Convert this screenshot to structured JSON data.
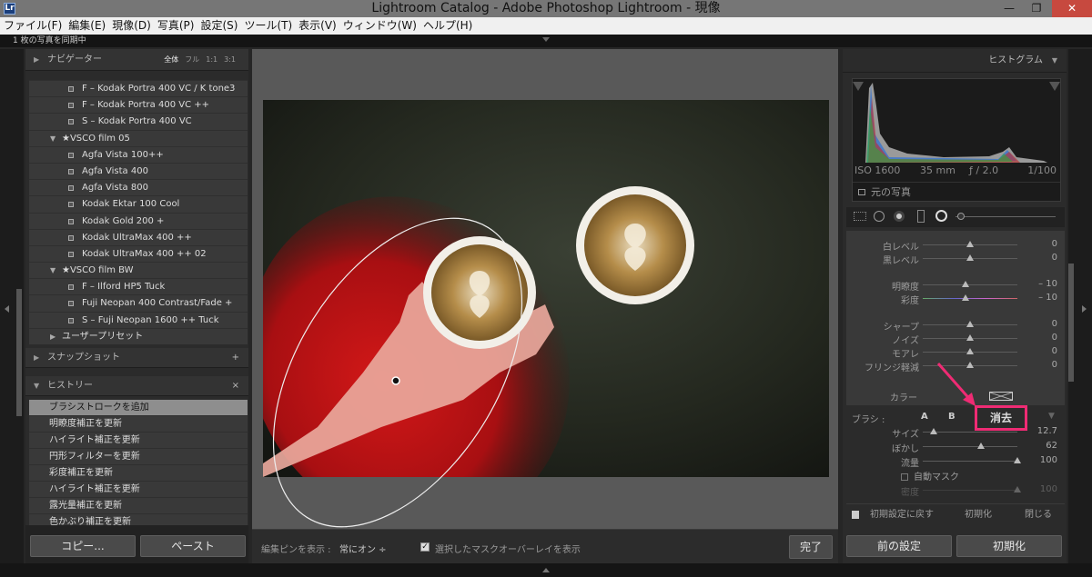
{
  "window": {
    "title": "Lightroom Catalog - Adobe Photoshop Lightroom - 現像",
    "logo": "Lr"
  },
  "menu": [
    "ファイル(F)",
    "編集(E)",
    "現像(D)",
    "写真(P)",
    "設定(S)",
    "ツール(T)",
    "表示(V)",
    "ウィンドウ(W)",
    "ヘルプ(H)"
  ],
  "sync_status": "1 枚の写真を同期中",
  "navigator": {
    "label": "ナビゲーター",
    "options": [
      "全体",
      "フル",
      "1:1",
      "3:1"
    ],
    "active": "全体"
  },
  "presets": [
    {
      "kind": "preset",
      "label": "F – Kodak Portra 400 VC / K tone3"
    },
    {
      "kind": "preset",
      "label": "F – Kodak Portra 400 VC ++"
    },
    {
      "kind": "preset",
      "label": "S – Kodak Portra 400 VC"
    },
    {
      "kind": "folder",
      "label": "★VSCO film 05"
    },
    {
      "kind": "preset",
      "label": "Agfa Vista 100++"
    },
    {
      "kind": "preset",
      "label": "Agfa Vista 400"
    },
    {
      "kind": "preset",
      "label": "Agfa Vista 800"
    },
    {
      "kind": "preset",
      "label": "Kodak Ektar 100 Cool"
    },
    {
      "kind": "preset",
      "label": "Kodak Gold 200 +"
    },
    {
      "kind": "preset",
      "label": "Kodak UltraMax 400 ++"
    },
    {
      "kind": "preset",
      "label": "Kodak UltraMax 400 ++ 02"
    },
    {
      "kind": "folder",
      "label": "★VSCO film BW"
    },
    {
      "kind": "preset",
      "label": "F – Ilford HP5 Tuck"
    },
    {
      "kind": "preset",
      "label": "Fuji Neopan 400 Contrast/Fade +"
    },
    {
      "kind": "preset",
      "label": "S – Fuji Neopan 1600 ++ Tuck"
    },
    {
      "kind": "folder-closed",
      "label": "ユーザープリセット"
    }
  ],
  "snapshot": {
    "label": "スナップショット",
    "add": "+"
  },
  "history": {
    "label": "ヒストリー",
    "clear": "×",
    "items": [
      "ブラシストロークを追加",
      "明瞭度補正を更新",
      "ハイライト補正を更新",
      "円形フィルターを更新",
      "彩度補正を更新",
      "ハイライト補正を更新",
      "露光量補正を更新",
      "色かぶり補正を更新"
    ]
  },
  "left_buttons": {
    "copy": "コピー...",
    "paste": "ペースト"
  },
  "toolbar": {
    "show_pins": "編集ピンを表示 :",
    "pins_value": "常にオン ÷",
    "overlay_label": "選択したマスクオーバーレイを表示",
    "overlay_checked": "✓",
    "done": "完了"
  },
  "histogram": {
    "label": "ヒストグラム",
    "iso": "ISO 1600",
    "focal": "35 mm",
    "aperture": "ƒ / 2.0",
    "shutter": "1/100",
    "original": "元の写真"
  },
  "sliders": [
    {
      "label": "白レベル",
      "value": "0",
      "pos": 0.5
    },
    {
      "label": "黒レベル",
      "value": "0",
      "pos": 0.5
    },
    {
      "label": "明瞭度",
      "value": "– 10",
      "pos": 0.45
    },
    {
      "label": "彩度",
      "value": "– 10",
      "pos": 0.45
    },
    {
      "label": "シャープ",
      "value": "0",
      "pos": 0.5
    },
    {
      "label": "ノイズ",
      "value": "0",
      "pos": 0.5
    },
    {
      "label": "モアレ",
      "value": "0",
      "pos": 0.5
    },
    {
      "label": "フリンジ軽減",
      "value": "0",
      "pos": 0.5
    }
  ],
  "color_label": "カラー",
  "brush": {
    "label": "ブラシ :",
    "a": "A",
    "b": "B",
    "erase": "消去"
  },
  "brush_sliders": [
    {
      "label": "サイズ",
      "value": "12.7",
      "pos": 0.12
    },
    {
      "label": "ぼかし",
      "value": "62",
      "pos": 0.62
    },
    {
      "label": "流量",
      "value": "100",
      "pos": 1.0
    }
  ],
  "auto_mask": "自動マスク",
  "density": {
    "label": "密度",
    "value": "100",
    "pos": 1.0
  },
  "footer": {
    "reset": "初期設定に戻す",
    "init": "初期化",
    "close": "閉じる"
  },
  "right_buttons": {
    "prev": "前の設定",
    "reset": "初期化"
  },
  "colors": {
    "accent": "#ef2b74",
    "mask": "#c01010"
  }
}
